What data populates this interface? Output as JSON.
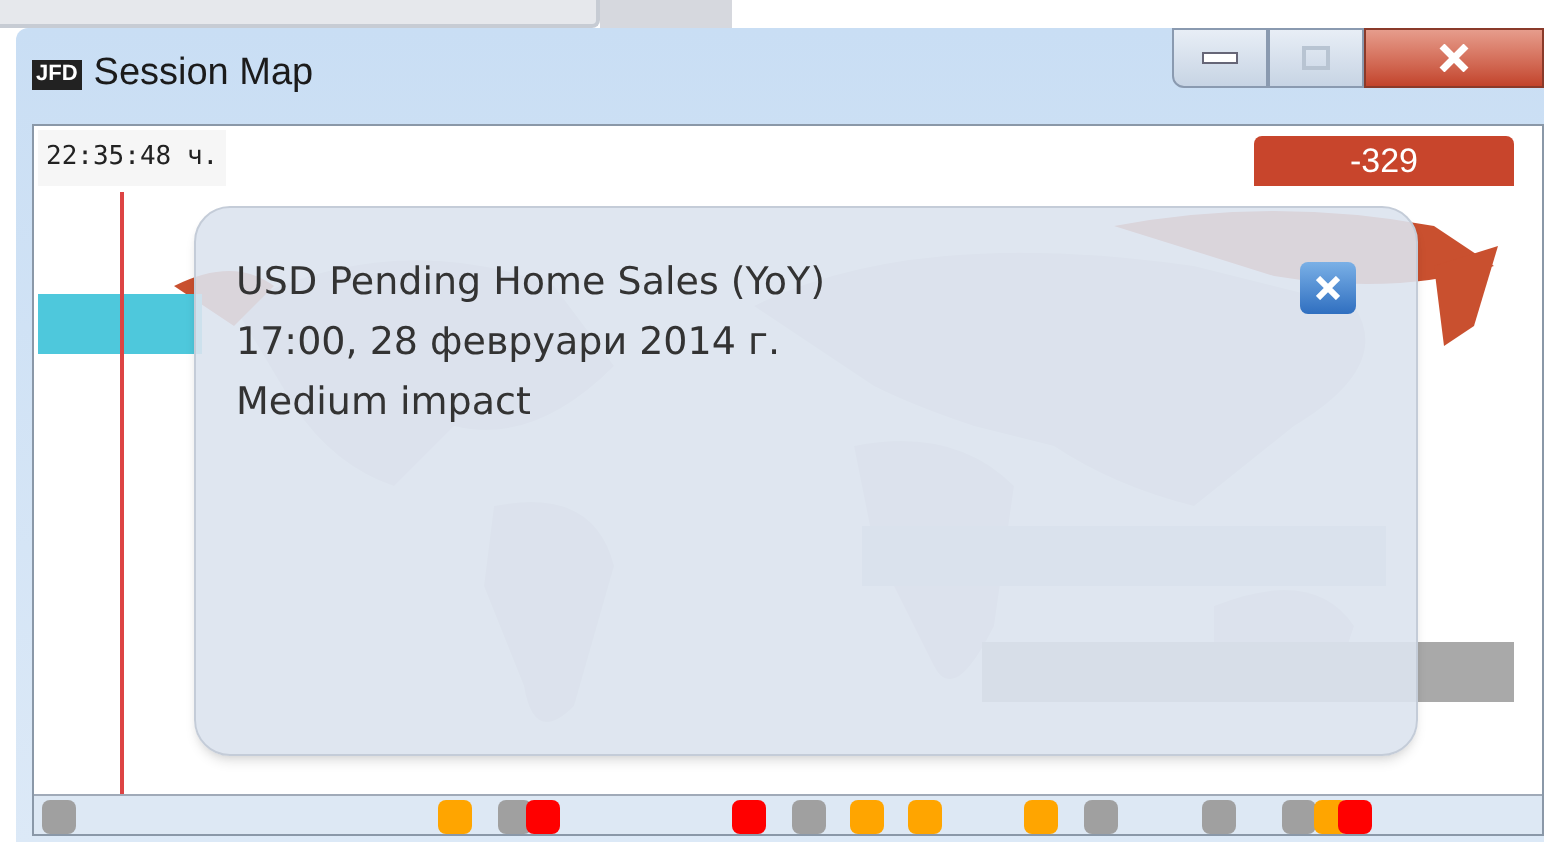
{
  "window": {
    "title": "Session Map",
    "logo": "JFD"
  },
  "clock": "22:35:48 ч.",
  "balance_badge": "-329",
  "popup": {
    "title": "USD Pending Home Sales (YoY)",
    "datetime": "17:00, 28 февруари 2014 г.",
    "impact": "Medium impact"
  },
  "events": [
    {
      "color": "#a0a0a0"
    },
    {
      "color": "#ffa500"
    },
    {
      "color": "#a0a0a0"
    },
    {
      "color": "#ff0000"
    },
    {
      "color": "#ff0000"
    },
    {
      "color": "#a0a0a0"
    },
    {
      "color": "#ffa500"
    },
    {
      "color": "#ffa500"
    },
    {
      "color": "#ffa500"
    },
    {
      "color": "#a0a0a0"
    },
    {
      "color": "#a0a0a0"
    },
    {
      "color": "#a0a0a0"
    },
    {
      "color": "#ffa500"
    },
    {
      "color": "#ff0000"
    }
  ]
}
